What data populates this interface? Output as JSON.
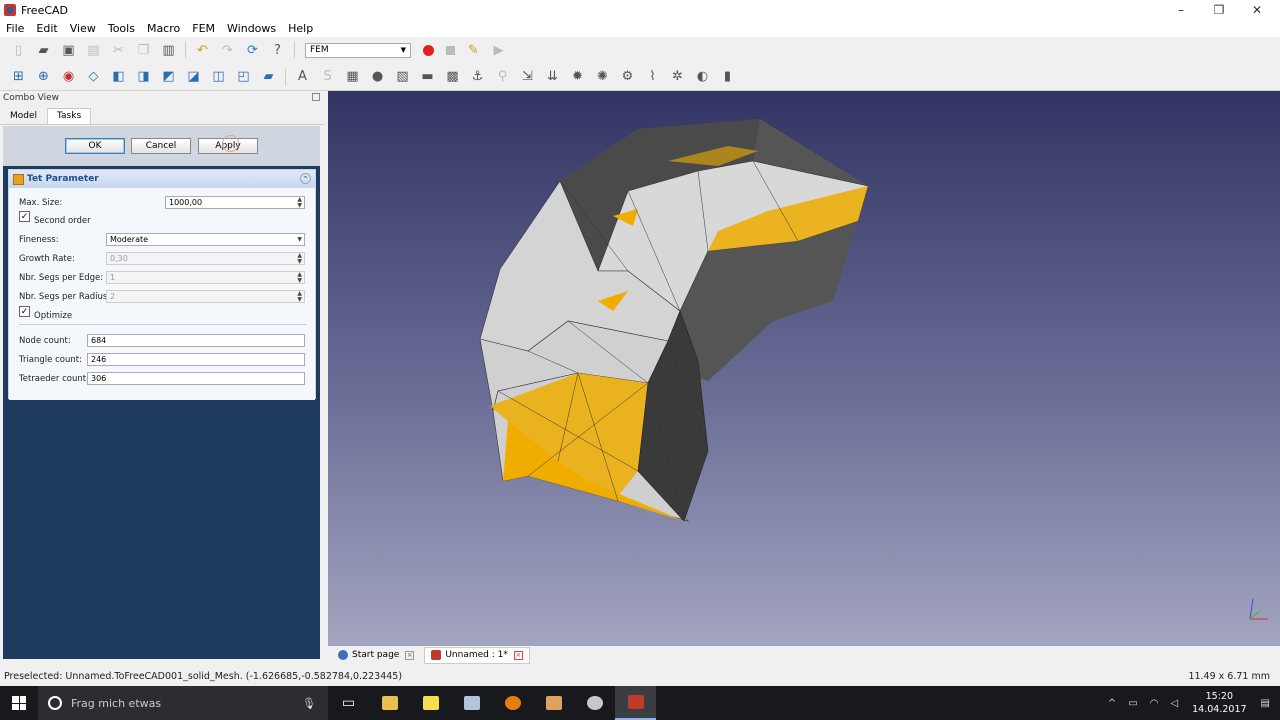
{
  "window": {
    "title": "FreeCAD"
  },
  "menu": [
    "File",
    "Edit",
    "View",
    "Tools",
    "Macro",
    "FEM",
    "Windows",
    "Help"
  ],
  "workbench": "FEM",
  "combo": {
    "header": "Combo View",
    "tabs": [
      "Model",
      "Tasks"
    ]
  },
  "task": {
    "ok": "OK",
    "cancel": "Cancel",
    "apply": "Apply",
    "panel_title": "Tet Parameter",
    "max_size_label": "Max. Size:",
    "max_size_value": "1000,00",
    "second_order_label": "Second order",
    "fineness_label": "Fineness:",
    "fineness_value": "Moderate",
    "growth_label": "Growth Rate:",
    "growth_value": "0,30",
    "segs_edge_label": "Nbr. Segs per Edge:",
    "segs_edge_value": "1",
    "segs_radius_label": "Nbr. Segs per Radius:",
    "segs_radius_value": "2",
    "optimize_label": "Optimize",
    "node_label": "Node count:",
    "node_value": "684",
    "triangle_label": "Triangle count:",
    "triangle_value": "246",
    "tet_label": "Tetraeder count:",
    "tet_value": "306"
  },
  "doctabs": [
    "Start page",
    "Unnamed : 1*"
  ],
  "status": {
    "preselected": "Preselected: Unnamed.ToFreeCAD001_solid_Mesh. (-1.626685,-0.582784,0.223445)",
    "dimensions": "11.49 x 6.71 mm"
  },
  "taskbar": {
    "search_placeholder": "Frag mich etwas",
    "time": "15:20",
    "date": "14.04.2017"
  },
  "colors": {
    "mesh_gray": "#d6d6d6",
    "mesh_orange": "#f0ad00",
    "mesh_dark": "#3a3a3a",
    "view_top": "#323463",
    "view_bottom": "#a3a5c0"
  }
}
